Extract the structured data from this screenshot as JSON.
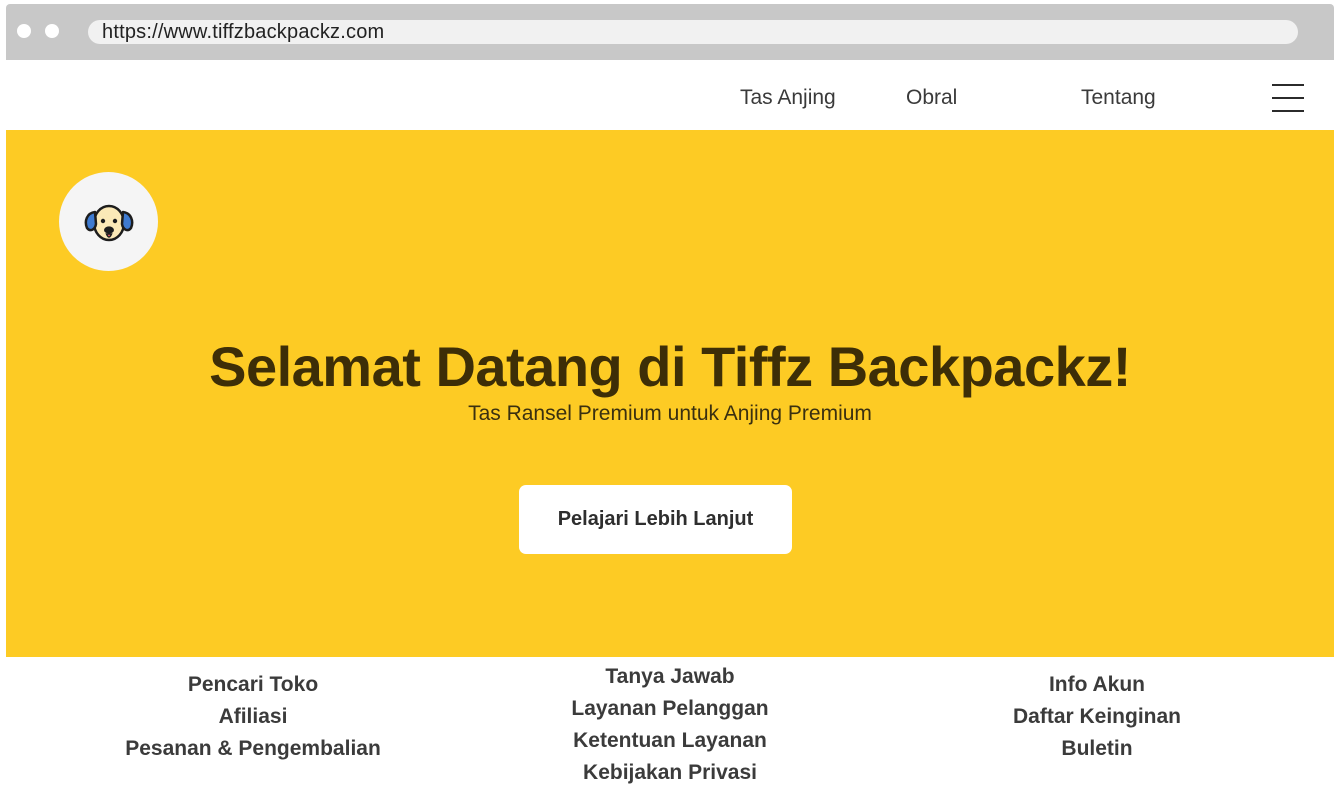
{
  "browser": {
    "url": "https://www.tiffzbackpackz.com"
  },
  "nav": {
    "items": [
      {
        "label": "Tas Anjing"
      },
      {
        "label": "Obral"
      },
      {
        "label": "Tentang"
      }
    ],
    "menu_icon": "hamburger-menu-icon"
  },
  "hero": {
    "logo_icon": "dog-face-icon",
    "title": "Selamat Datang di Tiffz Backpackz!",
    "subtitle": "Tas Ransel Premium untuk Anjing Premium",
    "cta_label": "Pelajari Lebih Lanjut",
    "background_color": "#FDCB24"
  },
  "footer": {
    "columns": [
      {
        "links": [
          "Pencari Toko",
          "Afiliasi",
          "Pesanan & Pengembalian"
        ]
      },
      {
        "links": [
          "Tanya Jawab",
          "Layanan Pelanggan",
          "Ketentuan Layanan",
          "Kebijakan Privasi"
        ]
      },
      {
        "links": [
          "Info Akun",
          "Daftar Keinginan",
          "Buletin"
        ]
      }
    ]
  },
  "colors": {
    "hero_background": "#FDCB24",
    "title_text": "#3D2E07",
    "browser_chrome": "#C8C8C8"
  }
}
